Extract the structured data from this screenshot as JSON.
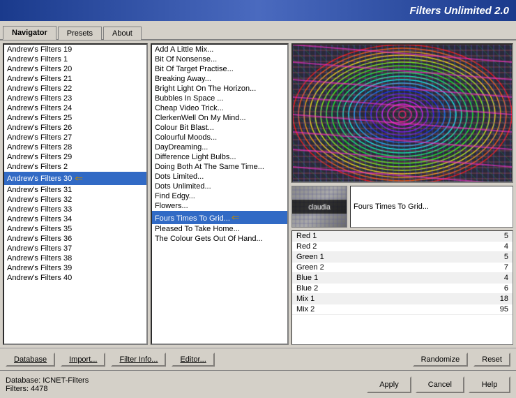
{
  "titleBar": {
    "text": "Filters Unlimited 2.0"
  },
  "tabs": [
    {
      "id": "navigator",
      "label": "Navigator",
      "active": true
    },
    {
      "id": "presets",
      "label": "Presets",
      "active": false
    },
    {
      "id": "about",
      "label": "About",
      "active": false
    }
  ],
  "leftPanel": {
    "items": [
      {
        "label": "Andrew's Filters 19",
        "selected": false,
        "arrow": false
      },
      {
        "label": "Andrew's Filters 1",
        "selected": false,
        "arrow": false
      },
      {
        "label": "Andrew's Filters 20",
        "selected": false,
        "arrow": false
      },
      {
        "label": "Andrew's Filters 21",
        "selected": false,
        "arrow": false
      },
      {
        "label": "Andrew's Filters 22",
        "selected": false,
        "arrow": false
      },
      {
        "label": "Andrew's Filters 23",
        "selected": false,
        "arrow": false
      },
      {
        "label": "Andrew's Filters 24",
        "selected": false,
        "arrow": false
      },
      {
        "label": "Andrew's Filters 25",
        "selected": false,
        "arrow": false
      },
      {
        "label": "Andrew's Filters 26",
        "selected": false,
        "arrow": false
      },
      {
        "label": "Andrew's Filters 27",
        "selected": false,
        "arrow": false
      },
      {
        "label": "Andrew's Filters 28",
        "selected": false,
        "arrow": false
      },
      {
        "label": "Andrew's Filters 29",
        "selected": false,
        "arrow": false
      },
      {
        "label": "Andrew's Filters 2",
        "selected": false,
        "arrow": false
      },
      {
        "label": "Andrew's Filters 30",
        "selected": true,
        "arrow": true
      },
      {
        "label": "Andrew's Filters 31",
        "selected": false,
        "arrow": false
      },
      {
        "label": "Andrew's Filters 32",
        "selected": false,
        "arrow": false
      },
      {
        "label": "Andrew's Filters 33",
        "selected": false,
        "arrow": false
      },
      {
        "label": "Andrew's Filters 34",
        "selected": false,
        "arrow": false
      },
      {
        "label": "Andrew's Filters 35",
        "selected": false,
        "arrow": false
      },
      {
        "label": "Andrew's Filters 36",
        "selected": false,
        "arrow": false
      },
      {
        "label": "Andrew's Filters 37",
        "selected": false,
        "arrow": false
      },
      {
        "label": "Andrew's Filters 38",
        "selected": false,
        "arrow": false
      },
      {
        "label": "Andrew's Filters 39",
        "selected": false,
        "arrow": false
      },
      {
        "label": "Andrew's Filters 40",
        "selected": false,
        "arrow": false
      }
    ]
  },
  "middlePanel": {
    "items": [
      {
        "label": "Add A Little Mix...",
        "selected": false,
        "arrow": false
      },
      {
        "label": "Bit Of Nonsense...",
        "selected": false,
        "arrow": false
      },
      {
        "label": "Bit Of Target Practise...",
        "selected": false,
        "arrow": false
      },
      {
        "label": "Breaking Away...",
        "selected": false,
        "arrow": false
      },
      {
        "label": "Bright Light On The Horizon...",
        "selected": false,
        "arrow": false
      },
      {
        "label": "Bubbles In Space ...",
        "selected": false,
        "arrow": false
      },
      {
        "label": "Cheap Video Trick...",
        "selected": false,
        "arrow": false
      },
      {
        "label": "ClerkenWell On My Mind...",
        "selected": false,
        "arrow": false
      },
      {
        "label": "Colour Bit Blast...",
        "selected": false,
        "arrow": false
      },
      {
        "label": "Colourful Moods...",
        "selected": false,
        "arrow": false
      },
      {
        "label": "DayDreaming...",
        "selected": false,
        "arrow": false
      },
      {
        "label": "Difference Light Bulbs...",
        "selected": false,
        "arrow": false
      },
      {
        "label": "Doing Both At The Same Time...",
        "selected": false,
        "arrow": false
      },
      {
        "label": "Dots Limited...",
        "selected": false,
        "arrow": false
      },
      {
        "label": "Dots Unlimited...",
        "selected": false,
        "arrow": false
      },
      {
        "label": "Find Edgy...",
        "selected": false,
        "arrow": false
      },
      {
        "label": "Flowers...",
        "selected": false,
        "arrow": false
      },
      {
        "label": "Fours Times To Grid...",
        "selected": true,
        "arrow": true
      },
      {
        "label": "Pleased To Take Home...",
        "selected": false,
        "arrow": false
      },
      {
        "label": "The Colour Gets Out Of Hand...",
        "selected": false,
        "arrow": false
      }
    ]
  },
  "filterInfo": {
    "name": "Fours Times To Grid...",
    "thumbLabel": "claudia"
  },
  "colorTable": {
    "rows": [
      {
        "label": "Red 1",
        "value": "5"
      },
      {
        "label": "Red 2",
        "value": "4"
      },
      {
        "label": "Green 1",
        "value": "5"
      },
      {
        "label": "Green 2",
        "value": "7"
      },
      {
        "label": "Blue 1",
        "value": "4"
      },
      {
        "label": "Blue 2",
        "value": "6"
      },
      {
        "label": "Mix 1",
        "value": "18"
      },
      {
        "label": "Mix 2",
        "value": "95"
      }
    ]
  },
  "bottomToolbar": {
    "database": "Database",
    "import": "Import...",
    "filterInfo": "Filter Info...",
    "editor": "Editor...",
    "randomize": "Randomize",
    "reset": "Reset"
  },
  "statusBar": {
    "line1": "Database:  ICNET-Filters",
    "line2": "Filters:     4478"
  },
  "actionButtons": {
    "apply": "Apply",
    "cancel": "Cancel",
    "help": "Help"
  }
}
